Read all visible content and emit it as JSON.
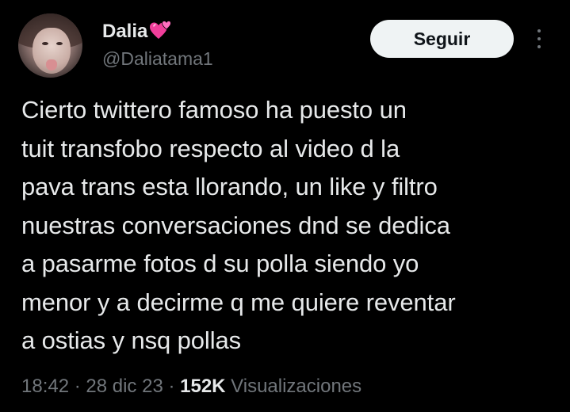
{
  "author": {
    "display_name": "Dalia",
    "name_emoji": "two-hearts-icon",
    "handle": "@Daliatama1"
  },
  "follow_label": "Seguir",
  "tweet": {
    "text": "Cierto twittero famoso ha puesto un\ntuit transfobo respecto al video d la\npava trans esta llorando, un like y filtro\nnuestras conversaciones dnd se dedica\na pasarme fotos d su polla siendo yo\nmenor y a decirme q me quiere reventar\na ostias y nsq pollas"
  },
  "meta": {
    "time": "18:42",
    "separator1": " · ",
    "date": "28 dic 23",
    "separator2": " · ",
    "views_count": "152K",
    "views_label": " Visualizaciones"
  },
  "colors": {
    "background": "#000000",
    "text_primary": "#e7e9ea",
    "text_secondary": "#71767b",
    "button_bg": "#eff3f4",
    "heart_pink": "#f03e9a"
  }
}
